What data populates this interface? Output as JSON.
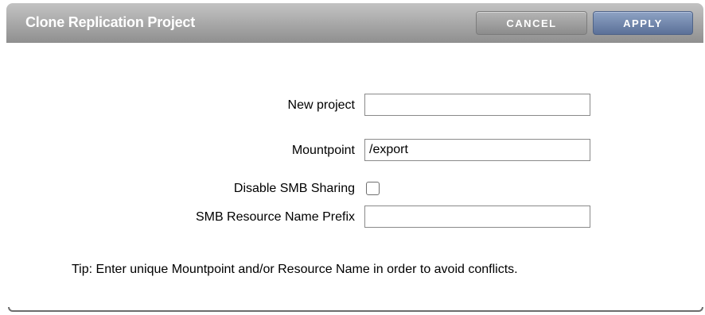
{
  "dialog": {
    "title": "Clone Replication Project",
    "cancel_label": "CANCEL",
    "apply_label": "APPLY"
  },
  "form": {
    "new_project": {
      "label": "New project",
      "value": ""
    },
    "mountpoint": {
      "label": "Mountpoint",
      "value": "/export"
    },
    "disable_smb": {
      "label": "Disable SMB Sharing",
      "checked": false
    },
    "smb_prefix": {
      "label": "SMB Resource Name Prefix",
      "value": ""
    }
  },
  "tip": "Tip: Enter unique Mountpoint and/or Resource Name in order to avoid conflicts.",
  "colors": {
    "titlebar": "#a9a9a9",
    "apply_button": "#6f84aa",
    "cancel_button": "#9e9e9e"
  }
}
